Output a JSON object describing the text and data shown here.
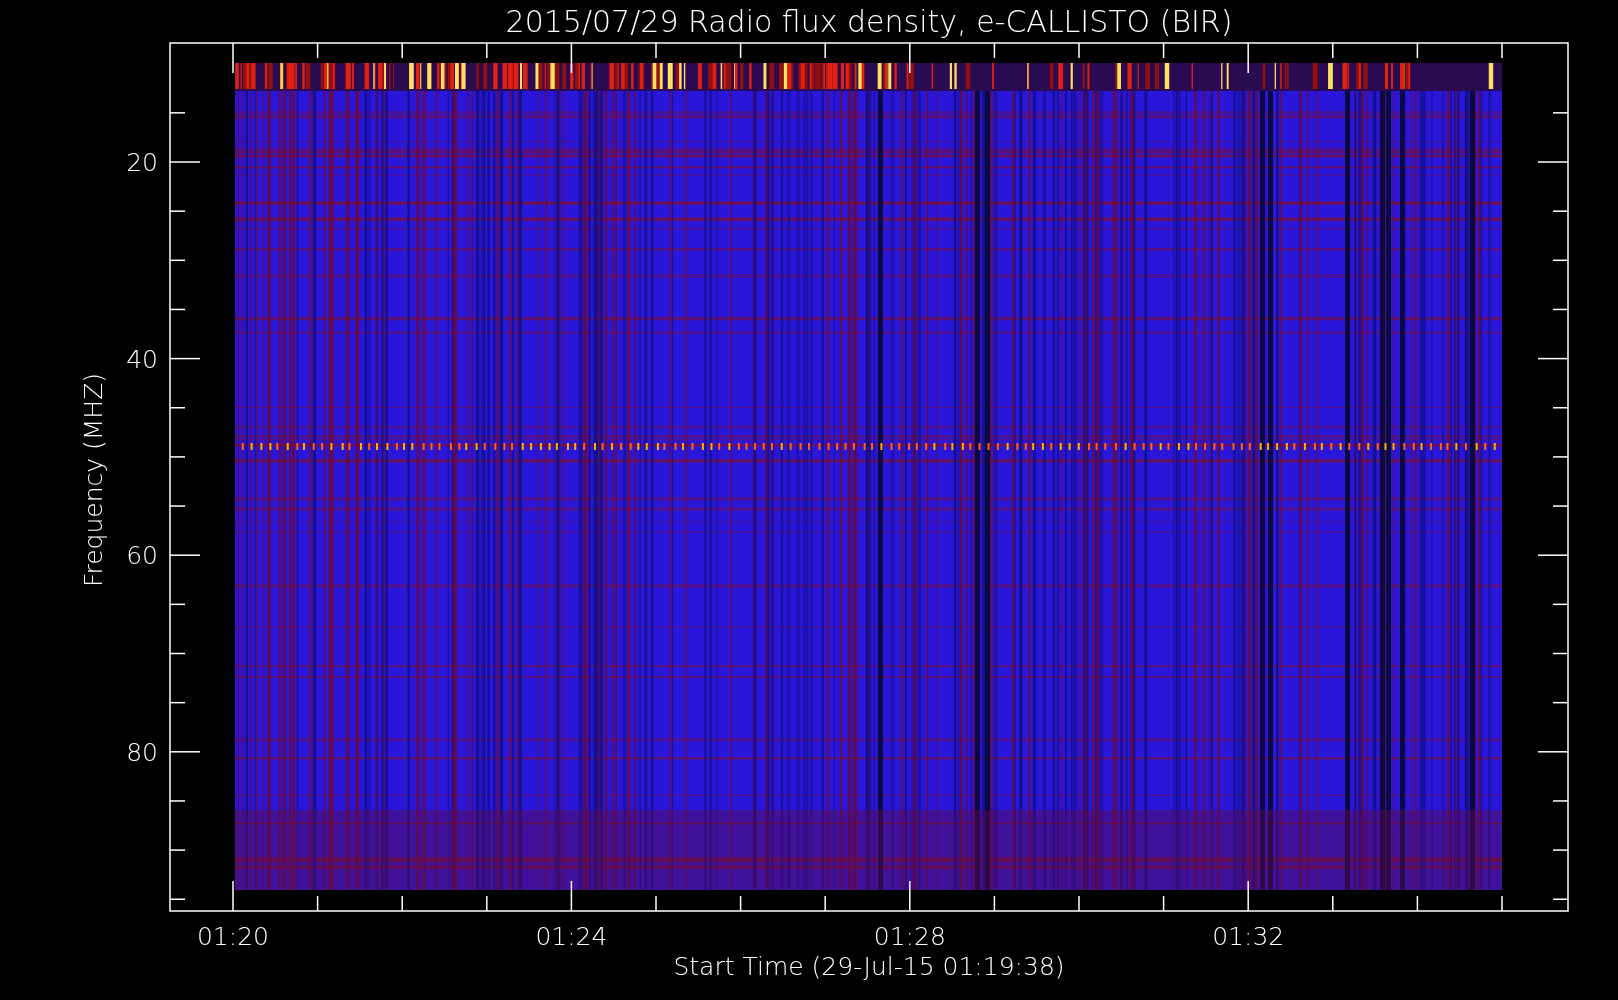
{
  "title": "2015/07/29  Radio flux density, e-CALLISTO (BIR)",
  "xlabel": "Start Time (29-Jul-15 01:19:38)",
  "ylabel": "Frequency (MHZ)",
  "xtick_labels": [
    "01:20",
    "01:24",
    "01:28",
    "01:32"
  ],
  "ytick_labels": [
    "20",
    "40",
    "60",
    "80"
  ]
}
